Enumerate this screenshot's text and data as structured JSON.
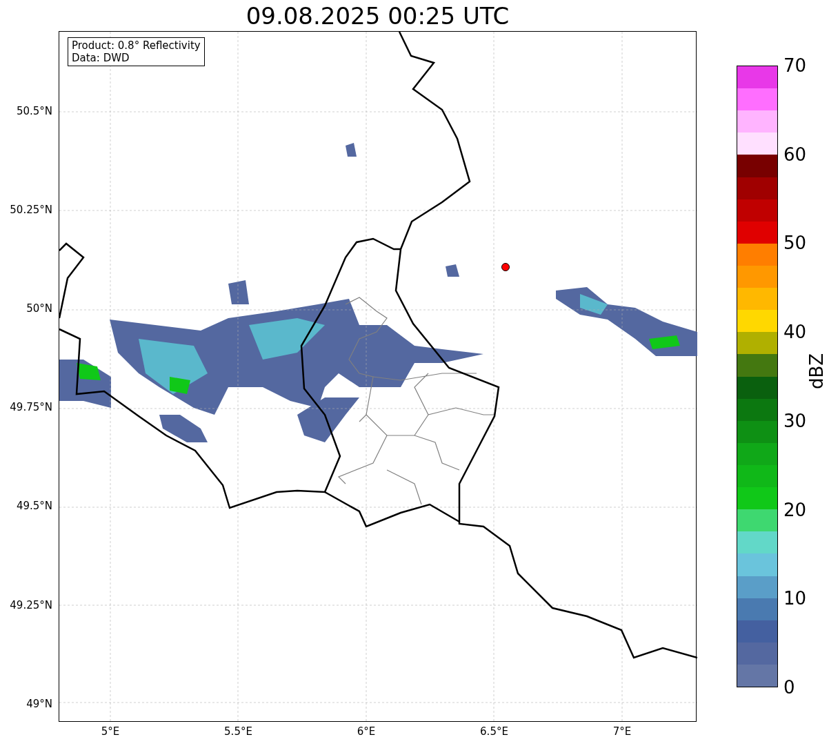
{
  "title": "09.08.2025 00:25 UTC",
  "info_box": [
    "Product: 0.8° Reflectivity",
    "Data: DWD"
  ],
  "map": {
    "y_ticks": [
      "50.5°N",
      "50.25°N",
      "50°N",
      "49.75°N",
      "49.5°N",
      "49.25°N",
      "49°N"
    ],
    "x_ticks": [
      "5°E",
      "5.5°E",
      "6°E",
      "6.5°E",
      "7°E"
    ]
  },
  "colorbar": {
    "label": "dBZ",
    "ticks": [
      "70",
      "60",
      "50",
      "40",
      "30",
      "20",
      "10",
      "0"
    ],
    "segments": [
      {
        "color": "#e838e8"
      },
      {
        "color": "#ff6eff"
      },
      {
        "color": "#ffb4ff"
      },
      {
        "color": "#ffe0ff"
      },
      {
        "color": "#780000"
      },
      {
        "color": "#a00000"
      },
      {
        "color": "#c00000"
      },
      {
        "color": "#e00000"
      },
      {
        "color": "#ff7e00"
      },
      {
        "color": "#ff9800"
      },
      {
        "color": "#ffb800"
      },
      {
        "color": "#ffd800"
      },
      {
        "color": "#b0b000"
      },
      {
        "color": "#447810"
      },
      {
        "color": "#0a600e"
      },
      {
        "color": "#0c7810"
      },
      {
        "color": "#0e9014"
      },
      {
        "color": "#10a818"
      },
      {
        "color": "#10b818"
      },
      {
        "color": "#10c818"
      },
      {
        "color": "#3ed870"
      },
      {
        "color": "#62d8c8"
      },
      {
        "color": "#6ac4dc"
      },
      {
        "color": "#5a9ec8"
      },
      {
        "color": "#4a7ab0"
      },
      {
        "color": "#4460a0"
      },
      {
        "color": "#5468a0"
      },
      {
        "color": "#6476a6"
      }
    ]
  }
}
